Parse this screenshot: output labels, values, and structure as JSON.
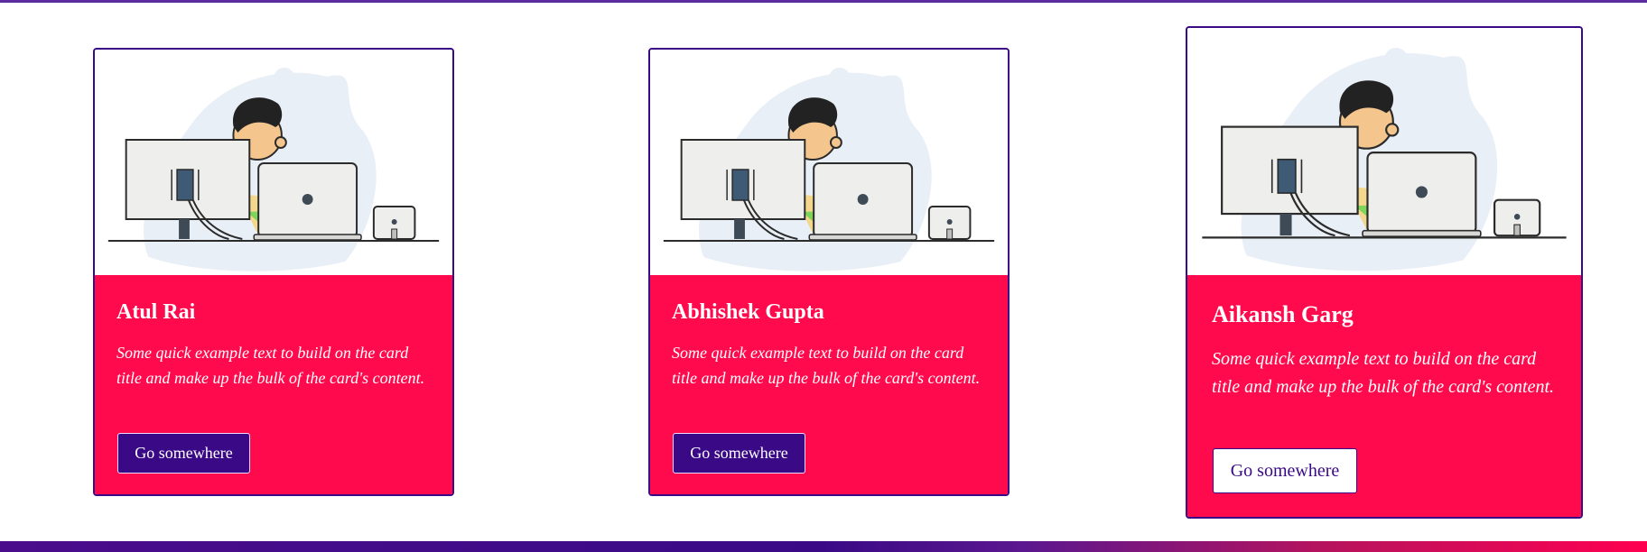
{
  "cards": [
    {
      "title": "Atul Rai",
      "text": "Some quick example text to build on the card title and make up the bulk of the card's content.",
      "button_label": "Go somewhere"
    },
    {
      "title": "Abhishek Gupta",
      "text": "Some quick example text to build on the card title and make up the bulk of the card's content.",
      "button_label": "Go somewhere"
    },
    {
      "title": "Aikansh Garg",
      "text": "Some quick example text to build on the card title and make up the bulk of the card's content.",
      "button_label": "Go somewhere"
    }
  ],
  "icons": {
    "card_image": "developer-at-desk-illustration"
  },
  "colors": {
    "card_body": "#ff0a4c",
    "accent": "#3a0a86",
    "button_hover_bg": "#ffffff"
  }
}
